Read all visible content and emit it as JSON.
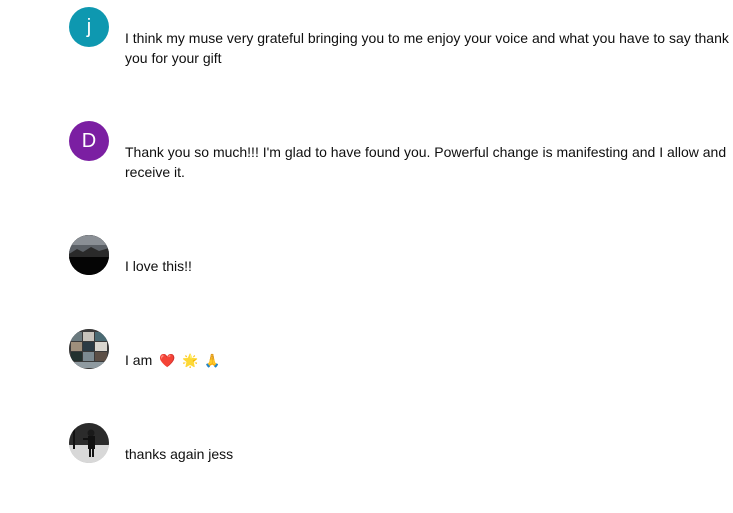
{
  "comments": [
    {
      "avatar": {
        "type": "letter",
        "letter": "j",
        "color": "#0e98b0"
      },
      "text": "I think my muse very grateful bringing you to me enjoy your voice and what you have to say thank you for your gift"
    },
    {
      "avatar": {
        "type": "letter",
        "letter": "D",
        "color": "#7b1fa2"
      },
      "text": "Thank you so much!!! I'm glad to have found you. Powerful change is manifesting and I allow and receive it."
    },
    {
      "avatar": {
        "type": "photo",
        "icon": "landscape-photo-avatar"
      },
      "text": "I love this!!"
    },
    {
      "avatar": {
        "type": "photo",
        "icon": "collage-photo-avatar"
      },
      "text_prefix": "I am",
      "emojis": [
        "❤️",
        "🌟",
        "🙏"
      ]
    },
    {
      "avatar": {
        "type": "photo",
        "icon": "person-photo-avatar"
      },
      "text": "thanks again jess"
    }
  ]
}
